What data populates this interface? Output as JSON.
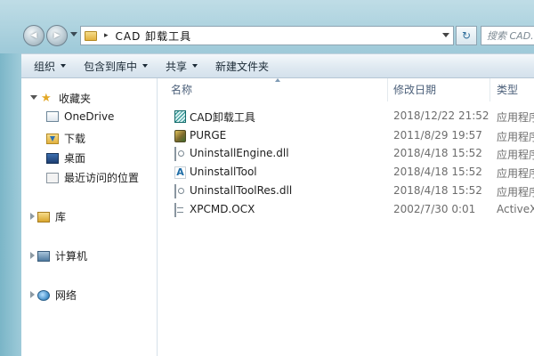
{
  "address_bar": {
    "path": "CAD 卸载工具",
    "separator": "▸",
    "search_placeholder": "搜索 CAD..."
  },
  "nav_buttons": {
    "back": "◀",
    "forward": "▶",
    "refresh": "↻"
  },
  "toolbar": {
    "organize": "组织",
    "include_in_library": "包含到库中",
    "share": "共享",
    "new_folder": "新建文件夹"
  },
  "nav_pane": {
    "favorites": "收藏夹",
    "favorites_items": [
      {
        "label": "OneDrive",
        "icon": "onedrive-icon"
      },
      {
        "label": "下载",
        "icon": "download-folder-icon"
      },
      {
        "label": "桌面",
        "icon": "desktop-icon"
      },
      {
        "label": "最近访问的位置",
        "icon": "recent-places-icon"
      }
    ],
    "libraries": "库",
    "computer": "计算机",
    "network": "网络"
  },
  "file_list": {
    "columns": {
      "name": "名称",
      "date_modified": "修改日期",
      "type": "类型"
    },
    "rows": [
      {
        "name": "CAD卸载工具",
        "date": "2018/12/22 21:52",
        "type": "应用程序",
        "icon": "cad-app-icon"
      },
      {
        "name": "PURGE",
        "date": "2011/8/29 19:57",
        "type": "应用程序",
        "icon": "purge-app-icon"
      },
      {
        "name": "UninstallEngine.dll",
        "date": "2018/4/18 15:52",
        "type": "应用程序扩展",
        "icon": "dll-file-icon"
      },
      {
        "name": "UninstallTool",
        "date": "2018/4/18 15:52",
        "type": "应用程序",
        "icon": "uninstall-tool-icon"
      },
      {
        "name": "UninstallToolRes.dll",
        "date": "2018/4/18 15:52",
        "type": "应用程序扩展",
        "icon": "dll-file-icon"
      },
      {
        "name": "XPCMD.OCX",
        "date": "2002/7/30 0:01",
        "type": "ActiveX",
        "icon": "ocx-file-icon"
      }
    ]
  }
}
